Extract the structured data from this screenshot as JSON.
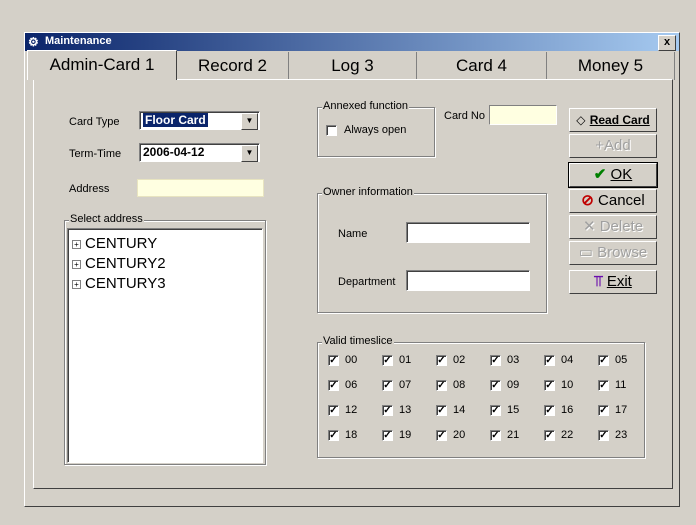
{
  "window": {
    "title": "Maintenance",
    "close": "x"
  },
  "tabs": [
    "Admin-Card 1",
    "Record 2",
    "Log 3",
    "Card 4",
    "Money 5"
  ],
  "form": {
    "card_type_label": "Card Type",
    "card_type_value": "Floor Card",
    "term_time_label": "Term-Time",
    "term_time_value": "2006-04-12",
    "address_label": "Address",
    "address_value": "",
    "select_address_label": "Select address",
    "tree": [
      "CENTURY",
      "CENTURY2",
      "CENTURY3"
    ],
    "annexed_label": "Annexed function",
    "always_open_label": "Always open",
    "card_no_label": "Card No",
    "card_no_value": "",
    "owner_label": "Owner information",
    "name_label": "Name",
    "name_value": "",
    "department_label": "Department",
    "department_value": "",
    "valid_timeslice_label": "Valid timeslice",
    "timeslices": [
      "00",
      "01",
      "02",
      "03",
      "04",
      "05",
      "06",
      "07",
      "08",
      "09",
      "10",
      "11",
      "12",
      "13",
      "14",
      "15",
      "16",
      "17",
      "18",
      "19",
      "20",
      "21",
      "22",
      "23"
    ]
  },
  "buttons": {
    "read_card": "Read Card",
    "add": "+Add",
    "ok": "OK",
    "cancel": "Cancel",
    "delete": "Delete",
    "browse": "Browse",
    "exit": "Exit"
  }
}
